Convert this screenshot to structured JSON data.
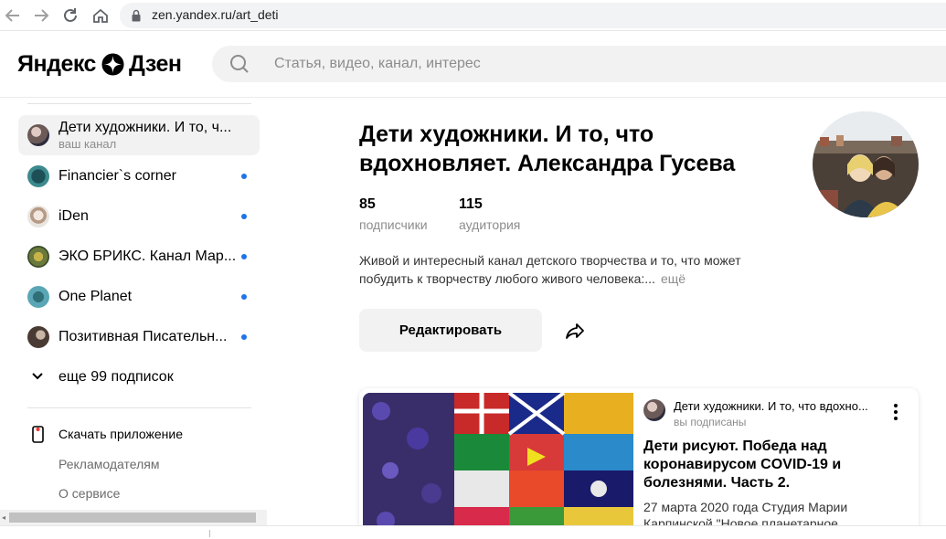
{
  "browser": {
    "url": "zen.yandex.ru/art_deti"
  },
  "header": {
    "logo_left": "Яндекс",
    "logo_right": "Дзен",
    "search_placeholder": "Статья, видео, канал, интерес"
  },
  "sidebar": {
    "channels": [
      {
        "name": "Дети художники. И то, ч...",
        "sub": "ваш канал",
        "active": true,
        "dot": false,
        "avatar_color": "#6b5a58"
      },
      {
        "name": "Financier`s corner",
        "dot": true,
        "avatar_color": "#3c8a8d"
      },
      {
        "name": "iDen",
        "dot": true,
        "avatar_color": "#d9d2c8"
      },
      {
        "name": "ЭКО БРИКС. Канал Мар...",
        "dot": true,
        "avatar_color": "#6a7a3c"
      },
      {
        "name": "One Planet",
        "dot": true,
        "avatar_color": "#5aa6b5"
      },
      {
        "name": "Позитивная Писательн...",
        "dot": true,
        "avatar_color": "#4a3a34"
      }
    ],
    "more_label": "еще 99 подписок",
    "app_label": "Скачать приложение",
    "footer_links": [
      "Рекламодателям",
      "О сервисе"
    ]
  },
  "channel": {
    "title": "Дети художники. И то, что вдохновляет. Александра Гусева",
    "subscribers": "85",
    "subscribers_label": "подписчики",
    "audience": "115",
    "audience_label": "аудитория",
    "description": "Живой и интересный канал детского творчества и то, что может побудить к творчеству любого живого человека:...",
    "more_link": "ещё",
    "edit_button": "Редактировать"
  },
  "card": {
    "channel_name": "Дети художники. И то, что вдохно...",
    "status": "вы подписаны",
    "title": "Дети рисуют. Победа над коронавирусом COVID-19 и болезнями. Часть 2.",
    "text": "27 марта 2020 года Студия Марии Карпинской \"Новое планетарное"
  },
  "colors": {
    "accent_dot": "#1e73e8",
    "muted_text": "#8c8c8c",
    "button_bg": "#f2f2f2"
  },
  "icons": [
    "back-icon",
    "forward-icon",
    "reload-icon",
    "home-icon",
    "lock-icon",
    "zen-star-icon",
    "search-icon",
    "chevron-down-icon",
    "phone-icon",
    "share-icon",
    "more-vertical-icon"
  ]
}
